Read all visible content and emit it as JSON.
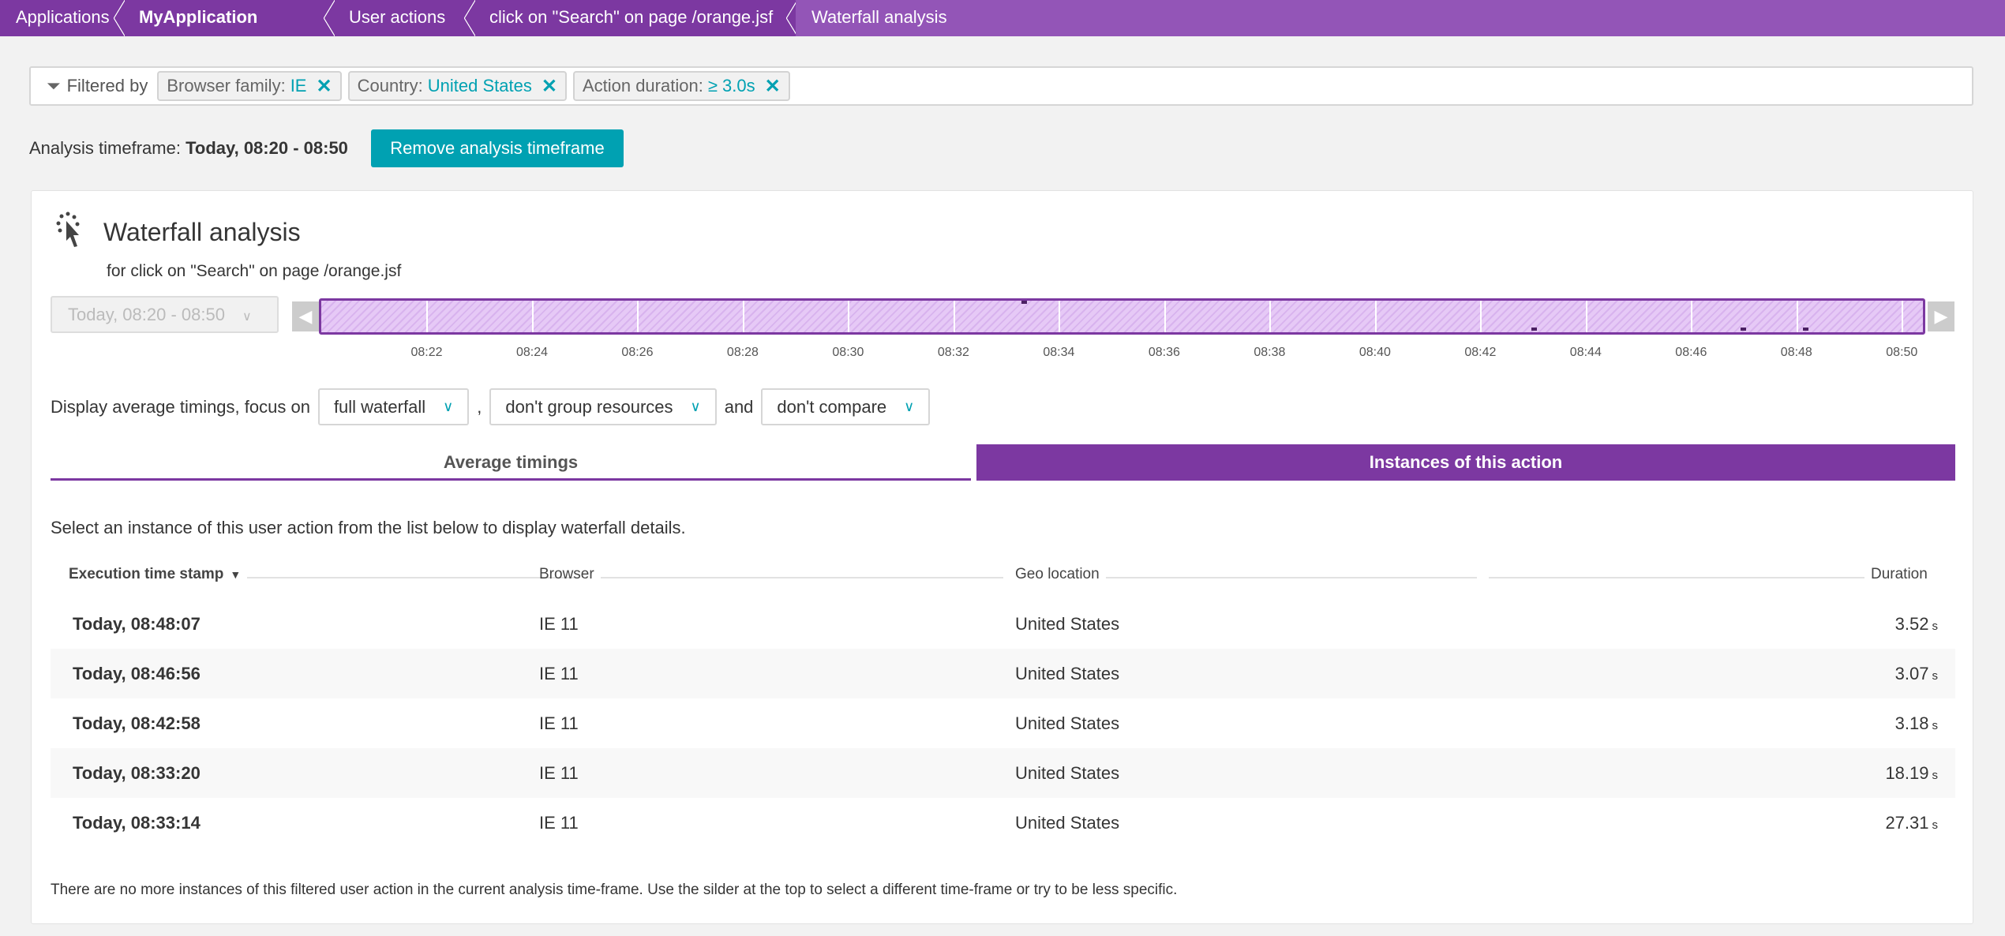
{
  "breadcrumb": [
    "Applications",
    "MyApplication",
    "User actions",
    "click on \"Search\" on page /orange.jsf",
    "Waterfall analysis"
  ],
  "filter": {
    "label": "Filtered by",
    "chips": [
      {
        "key": "Browser family:",
        "value": "IE"
      },
      {
        "key": "Country:",
        "value": "United States"
      },
      {
        "key": "Action duration:",
        "value": "≥ 3.0s"
      }
    ]
  },
  "timeframe": {
    "label": "Analysis timeframe:",
    "value": "Today, 08:20 - 08:50",
    "remove_button": "Remove analysis timeframe"
  },
  "card": {
    "title": "Waterfall analysis",
    "subtitle": "for click on \"Search\" on page /orange.jsf",
    "icon": "cursor-click-icon",
    "date_select": "Today, 08:20 - 08:50",
    "timeline": {
      "start": "08:20",
      "end": "08:50",
      "ticks": [
        "08:22",
        "08:24",
        "08:26",
        "08:28",
        "08:30",
        "08:32",
        "08:34",
        "08:36",
        "08:38",
        "08:40",
        "08:42",
        "08:44",
        "08:46",
        "08:48",
        "08:50"
      ],
      "markers": [
        "08:33:17",
        "08:42:58",
        "08:46:56",
        "08:48:07"
      ]
    },
    "display": {
      "prefix": "Display average timings, focus on",
      "focus": "full waterfall",
      "sep": ",",
      "group": "don't group resources",
      "and": "and",
      "compare": "don't compare"
    },
    "tabs": [
      "Average timings",
      "Instances of this action"
    ],
    "info": "Select an instance of this user action from the list below to display waterfall details.",
    "columns": [
      "Execution time stamp",
      "Browser",
      "Geo location",
      "Duration"
    ],
    "sort_icon": "▼",
    "rows": [
      {
        "ts": "Today, 08:48:07",
        "browser": "IE 11",
        "geo": "United States",
        "dur": "3.52",
        "unit": "s"
      },
      {
        "ts": "Today, 08:46:56",
        "browser": "IE 11",
        "geo": "United States",
        "dur": "3.07",
        "unit": "s"
      },
      {
        "ts": "Today, 08:42:58",
        "browser": "IE 11",
        "geo": "United States",
        "dur": "3.18",
        "unit": "s"
      },
      {
        "ts": "Today, 08:33:20",
        "browser": "IE 11",
        "geo": "United States",
        "dur": "18.19",
        "unit": "s"
      },
      {
        "ts": "Today, 08:33:14",
        "browser": "IE 11",
        "geo": "United States",
        "dur": "27.31",
        "unit": "s"
      }
    ],
    "footer": "There are no more instances of this filtered user action in the current analysis time-frame. Use the silder at the top to select a different time-frame or try to be less specific."
  },
  "colors": {
    "purple": "#7c38a1",
    "teal": "#00a1b2"
  }
}
